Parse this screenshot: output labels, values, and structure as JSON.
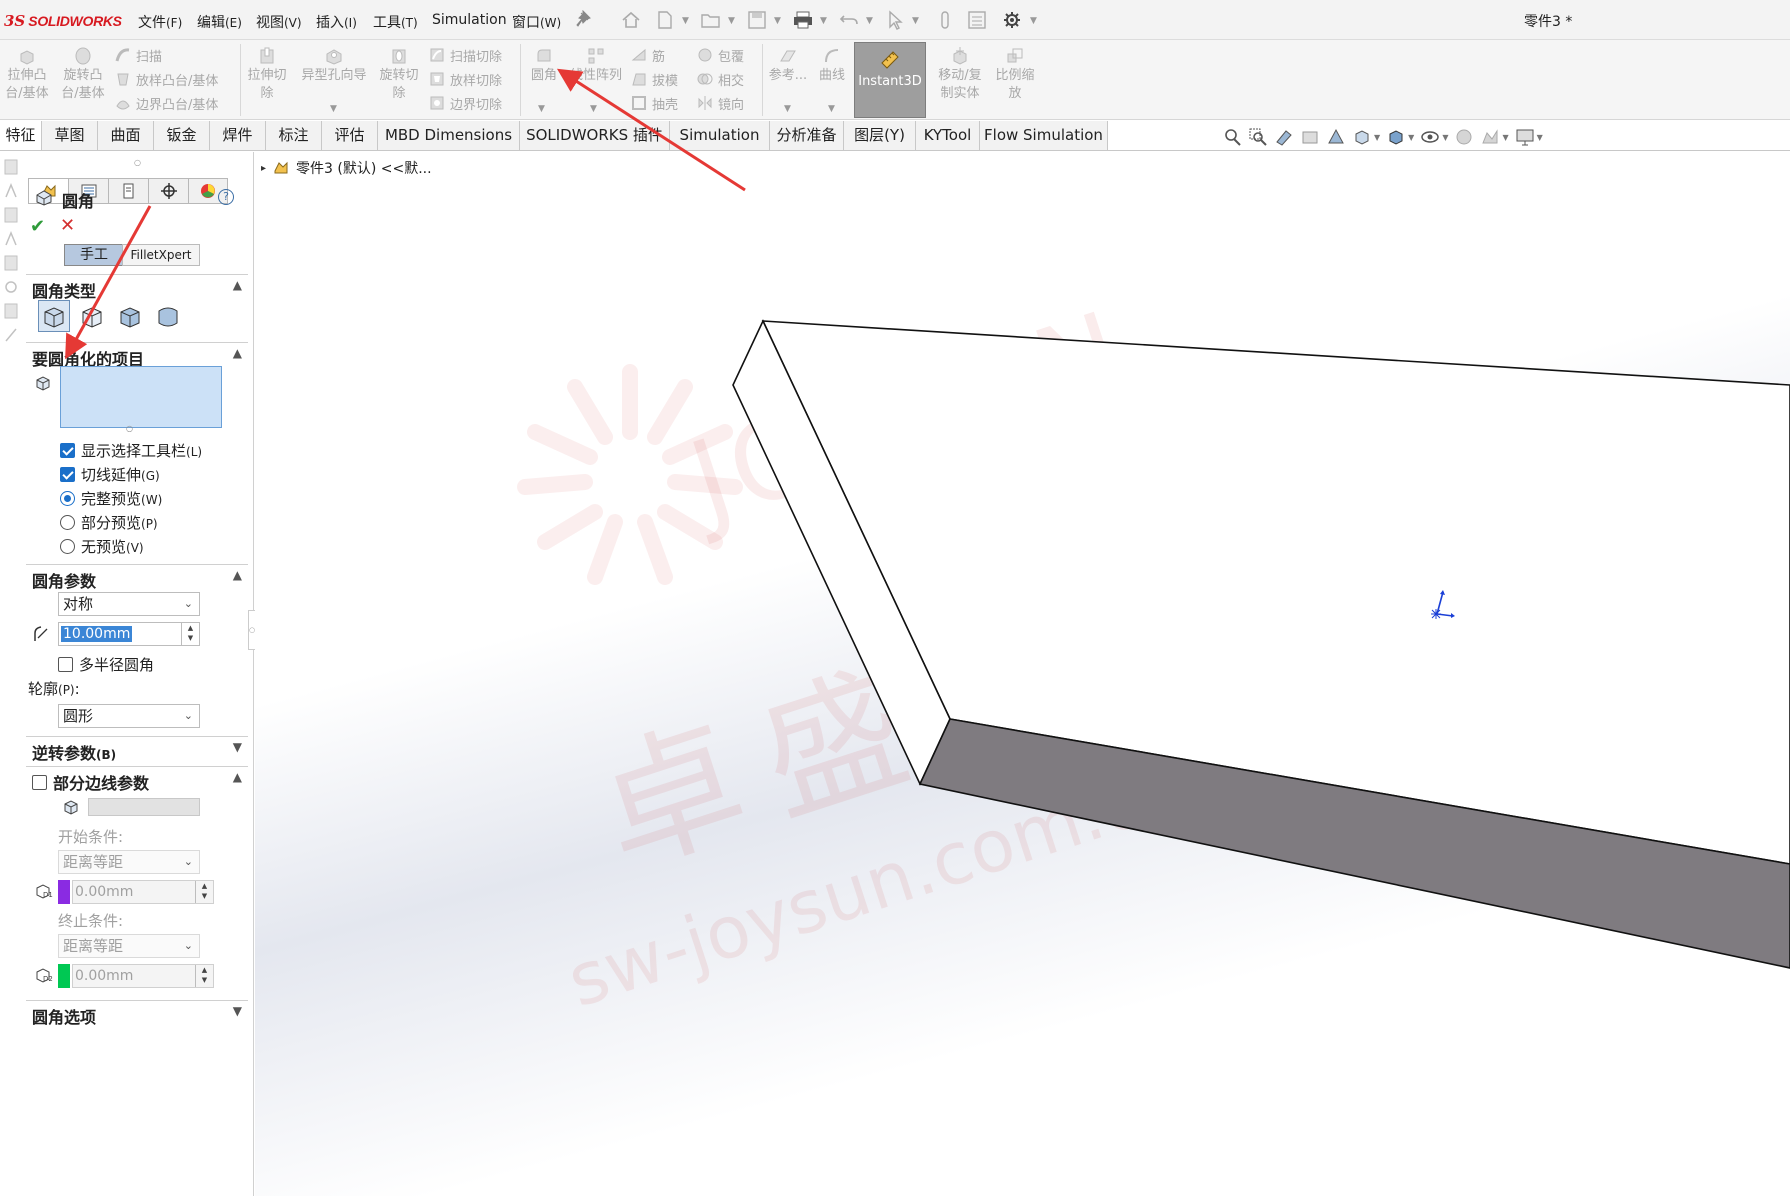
{
  "app": {
    "brand_prefix": "3S",
    "brand": "SOLIDWORKS",
    "document_title": "零件3 *"
  },
  "menu": [
    {
      "label": "文件",
      "key": "(F)"
    },
    {
      "label": "编辑",
      "key": "(E)"
    },
    {
      "label": "视图",
      "key": "(V)"
    },
    {
      "label": "插入",
      "key": "(I)"
    },
    {
      "label": "工具",
      "key": "(T)"
    },
    {
      "label": "Simulation",
      "key": ""
    },
    {
      "label": "窗口",
      "key": "(W)"
    }
  ],
  "ribbon": {
    "extrude_boss": "拉伸凸台/基体",
    "revolve_boss": "旋转凸台/基体",
    "sweep": "扫描",
    "loft_boss": "放样凸台/基体",
    "boundary_boss": "边界凸台/基体",
    "extrude_cut": "拉伸切除",
    "hole_wizard": "异型孔向导",
    "revolve_cut": "旋转切除",
    "sweep_cut": "扫描切除",
    "loft_cut": "放样切除",
    "boundary_cut": "边界切除",
    "fillet": "圆角",
    "linear_pattern": "线性阵列",
    "rib": "筋",
    "draft": "拔模",
    "shell": "抽壳",
    "wrap": "包覆",
    "intersect": "相交",
    "mirror": "镜向",
    "reference": "参考...",
    "curves": "曲线",
    "instant3d": "Instant3D",
    "move_copy": "移动/复制实体",
    "scale": "比例缩放"
  },
  "tabs": [
    "特征",
    "草图",
    "曲面",
    "钣金",
    "焊件",
    "标注",
    "评估",
    "MBD Dimensions",
    "SOLIDWORKS 插件",
    "Simulation",
    "分析准备",
    "图层(Y)",
    "KYTool",
    "Flow Simulation"
  ],
  "tree": {
    "item": "零件3 (默认) <<默..."
  },
  "property_manager": {
    "title": "圆角",
    "mode_manual": "手工",
    "mode_filletxpert": "FilletXpert",
    "fillet_type": {
      "header": "圆角类型"
    },
    "items_to_fillet": {
      "header": "要圆角化的项目",
      "options": [
        {
          "label": "显示选择工具栏",
          "key": "(L)",
          "checked": true
        },
        {
          "label": "切线延伸",
          "key": "(G)",
          "checked": true
        }
      ],
      "preview": [
        {
          "label": "完整预览",
          "key": "(W)",
          "selected": true
        },
        {
          "label": "部分预览",
          "key": "(P)",
          "selected": false
        },
        {
          "label": "无预览",
          "key": "(V)",
          "selected": false
        }
      ]
    },
    "fillet_params": {
      "header": "圆角参数",
      "method": "对称",
      "radius": "10.00mm",
      "multi_radius": "多半径圆角",
      "profile_label": "轮廓",
      "profile_key": "(P)",
      "profile_colon": ":",
      "profile": "圆形"
    },
    "setback": {
      "header": "逆转参数",
      "key": "(B)"
    },
    "partial_edge": {
      "header": "部分边线参数",
      "start_label": "开始条件:",
      "start_value": "距离等距",
      "d1_value": "0.00mm",
      "end_label": "终止条件:",
      "end_value": "距离等距",
      "d2_value": "0.00mm"
    },
    "fillet_options": {
      "header": "圆角选项"
    }
  },
  "watermark": {
    "cn": "卓盛信息",
    "en": "JOYSUN",
    "url": "sw-joysun.com.cn"
  },
  "colors": {
    "accent": "#1a6fc9",
    "annotation_arrow": "#e53935",
    "brand": "#d71920",
    "d1_swatch": "#8a2be2",
    "d2_swatch": "#00c853",
    "face_dark": "#7f7b80"
  }
}
